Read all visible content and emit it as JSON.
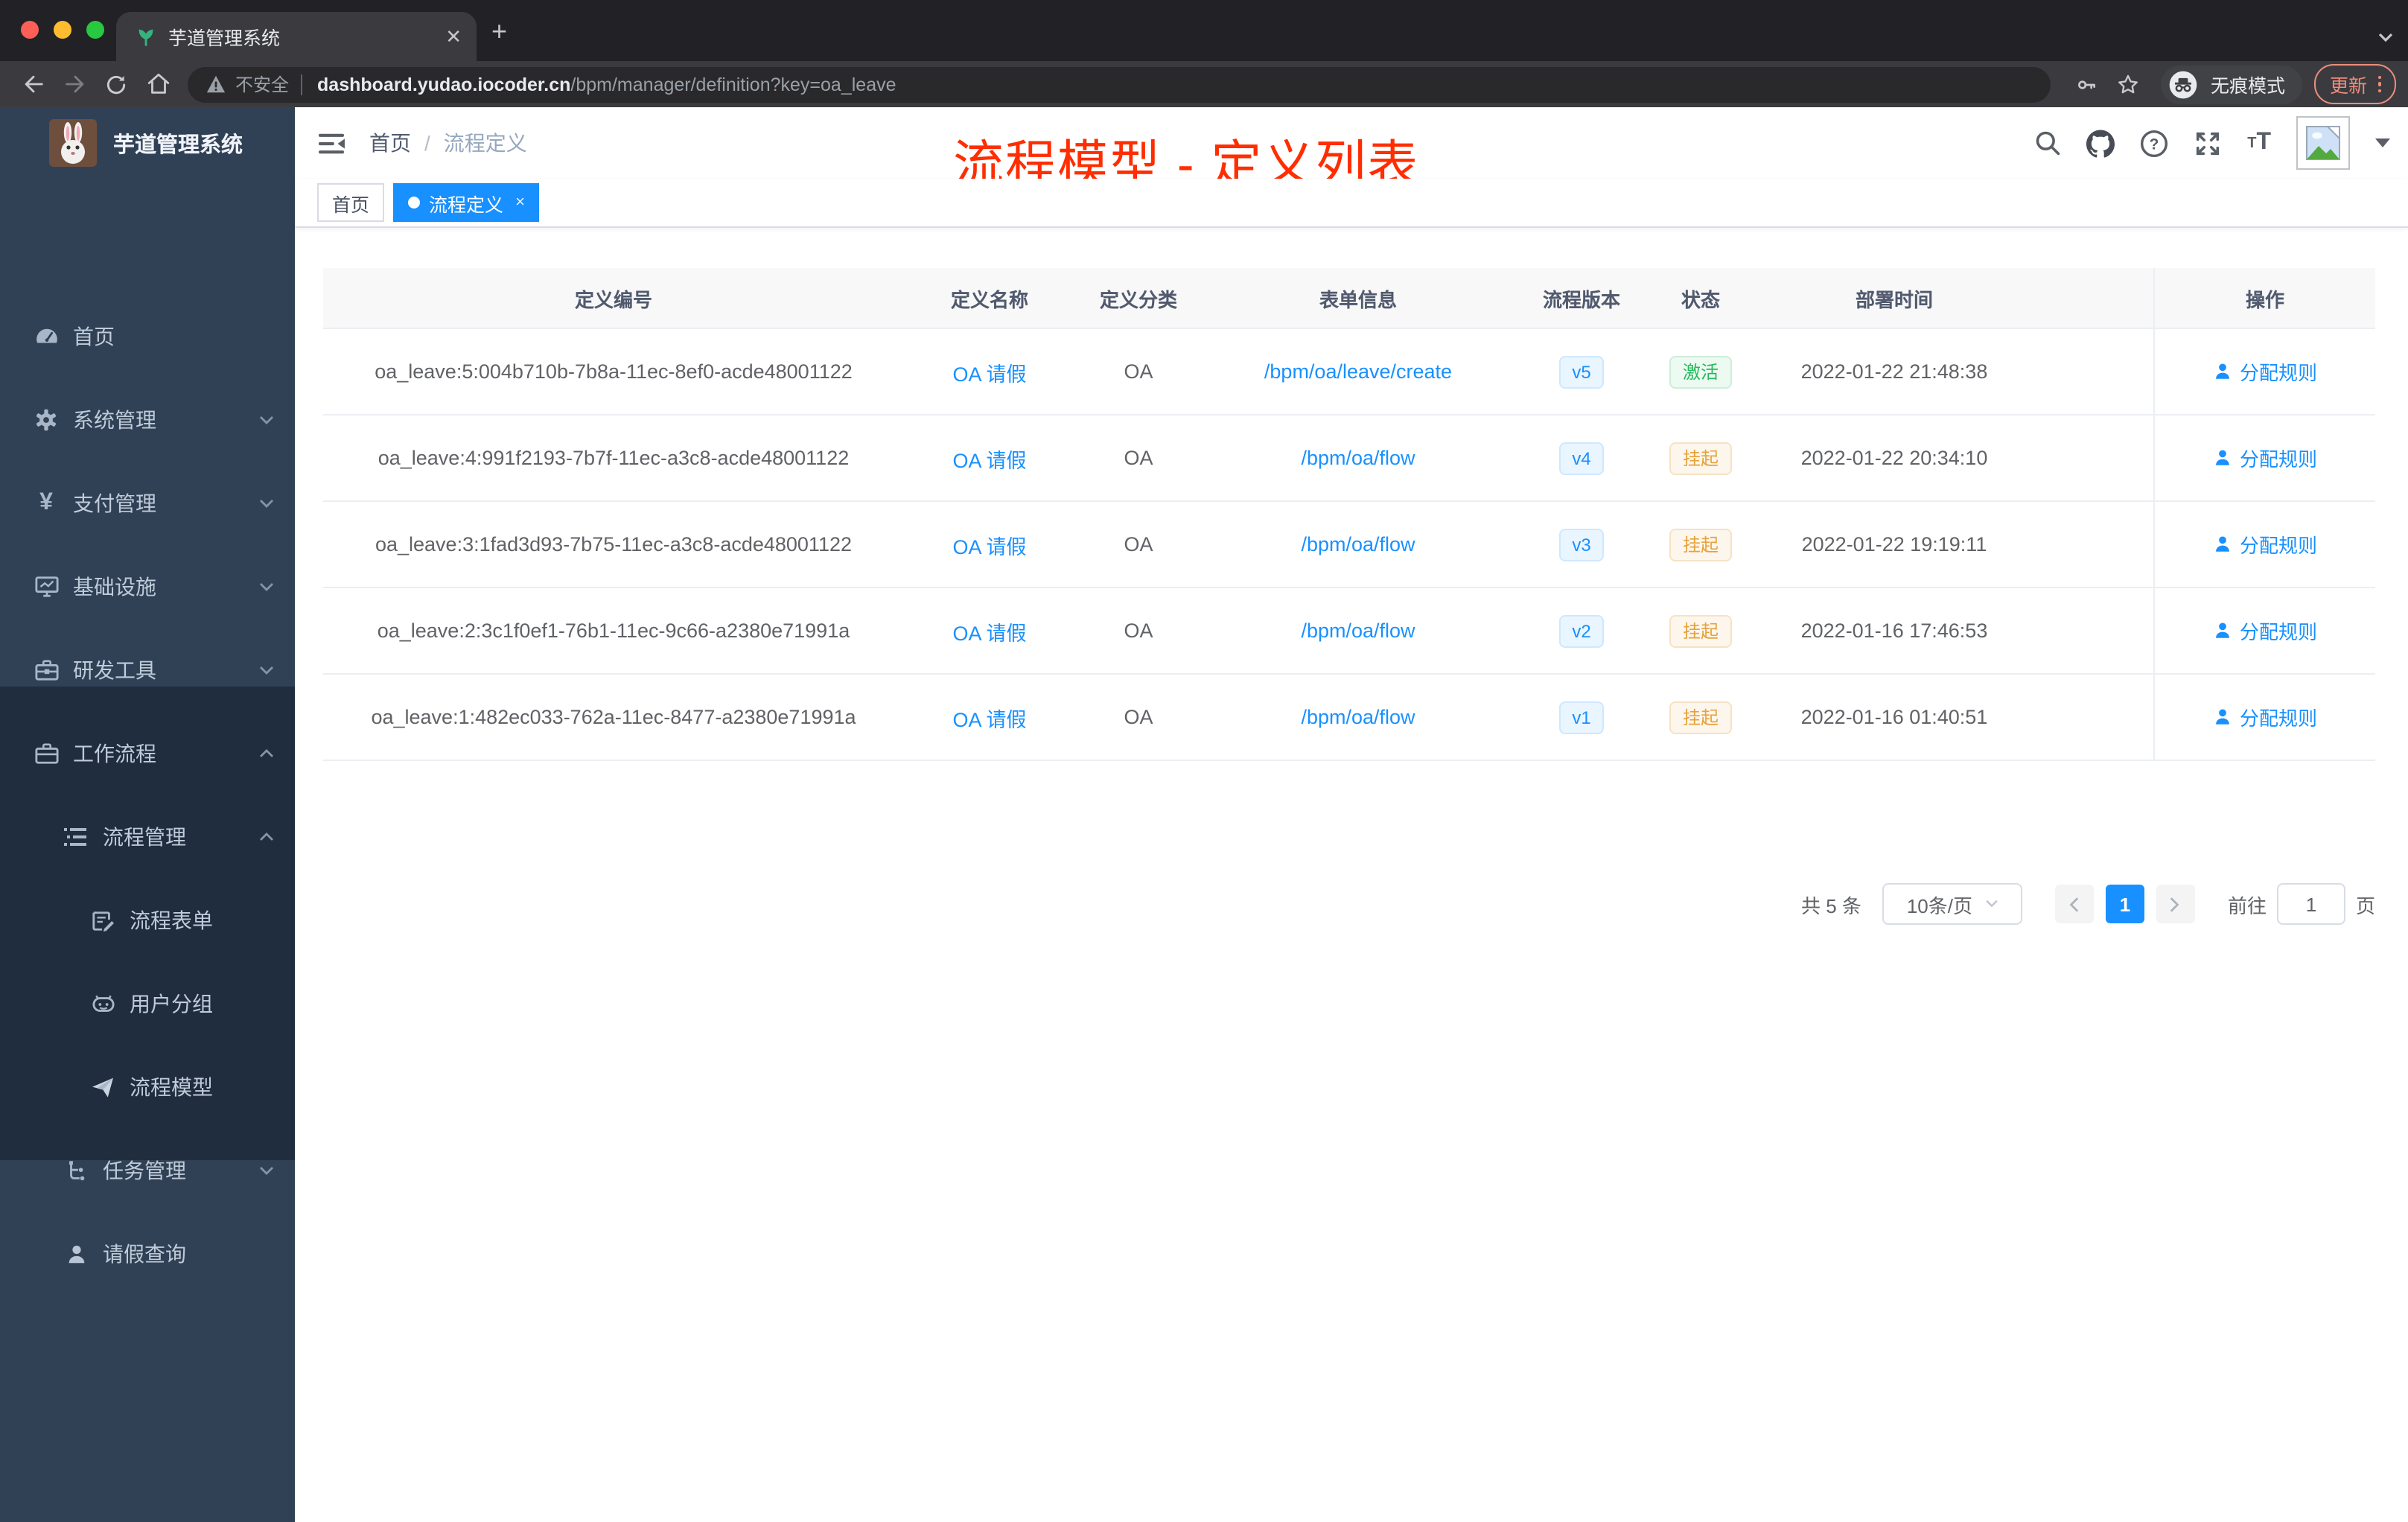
{
  "browser": {
    "tab_title": "芋道管理系统",
    "new_tab": "+",
    "close_tab": "✕",
    "security_label": "不安全",
    "url_host": "dashboard.yudao.iocoder.cn",
    "url_path": "/bpm/manager/definition?key=oa_leave",
    "incognito_label": "无痕模式",
    "update_label": "更新"
  },
  "sidebar": {
    "app_title": "芋道管理系统",
    "items": [
      {
        "label": "首页",
        "icon": "dashboard-icon"
      },
      {
        "label": "系统管理",
        "icon": "gear-icon",
        "chevron": "down"
      },
      {
        "label": "支付管理",
        "icon": "yen-icon",
        "chevron": "down"
      },
      {
        "label": "基础设施",
        "icon": "monitor-icon",
        "chevron": "down"
      },
      {
        "label": "研发工具",
        "icon": "toolbox-icon",
        "chevron": "down"
      },
      {
        "label": "工作流程",
        "icon": "briefcase-icon",
        "chevron": "up"
      },
      {
        "label": "流程管理",
        "icon": "list-icon",
        "chevron": "up"
      },
      {
        "label": "流程表单",
        "icon": "form-icon"
      },
      {
        "label": "用户分组",
        "icon": "robot-icon"
      },
      {
        "label": "流程模型",
        "icon": "paper-plane-icon"
      },
      {
        "label": "任务管理",
        "icon": "tree-icon",
        "chevron": "down"
      },
      {
        "label": "请假查询",
        "icon": "person-icon"
      }
    ]
  },
  "header": {
    "breadcrumb_home": "首页",
    "breadcrumb_sep": "/",
    "breadcrumb_current": "流程定义",
    "annotation": "流程模型 - 定义列表",
    "annotation_color": "#ff2d00"
  },
  "tags": {
    "home": "首页",
    "active": "流程定义",
    "close": "×"
  },
  "accent_color": "#1890ff",
  "status_colors": {
    "active": "#23b95c",
    "suspended": "#e6a23c"
  },
  "table": {
    "columns": [
      "定义编号",
      "定义名称",
      "定义分类",
      "表单信息",
      "流程版本",
      "状态",
      "部署时间",
      "操作"
    ],
    "rows": [
      {
        "id": "oa_leave:5:004b710b-7b8a-11ec-8ef0-acde48001122",
        "name": "OA 请假",
        "category": "OA",
        "form": "/bpm/oa/leave/create",
        "version": "v5",
        "status": "激活",
        "status_type": "success",
        "deploy_time": "2022-01-22 21:48:38",
        "action": "分配规则"
      },
      {
        "id": "oa_leave:4:991f2193-7b7f-11ec-a3c8-acde48001122",
        "name": "OA 请假",
        "category": "OA",
        "form": "/bpm/oa/flow",
        "version": "v4",
        "status": "挂起",
        "status_type": "warning",
        "deploy_time": "2022-01-22 20:34:10",
        "action": "分配规则"
      },
      {
        "id": "oa_leave:3:1fad3d93-7b75-11ec-a3c8-acde48001122",
        "name": "OA 请假",
        "category": "OA",
        "form": "/bpm/oa/flow",
        "version": "v3",
        "status": "挂起",
        "status_type": "warning",
        "deploy_time": "2022-01-22 19:19:11",
        "action": "分配规则"
      },
      {
        "id": "oa_leave:2:3c1f0ef1-76b1-11ec-9c66-a2380e71991a",
        "name": "OA 请假",
        "category": "OA",
        "form": "/bpm/oa/flow",
        "version": "v2",
        "status": "挂起",
        "status_type": "warning",
        "deploy_time": "2022-01-16 17:46:53",
        "action": "分配规则"
      },
      {
        "id": "oa_leave:1:482ec033-762a-11ec-8477-a2380e71991a",
        "name": "OA 请假",
        "category": "OA",
        "form": "/bpm/oa/flow",
        "version": "v1",
        "status": "挂起",
        "status_type": "warning",
        "deploy_time": "2022-01-16 01:40:51",
        "action": "分配规则"
      }
    ]
  },
  "pagination": {
    "total_label": "共 5 条",
    "page_size": "10条/页",
    "current_page": "1",
    "goto_label": "前往",
    "goto_value": "1",
    "page_suffix": "页"
  }
}
